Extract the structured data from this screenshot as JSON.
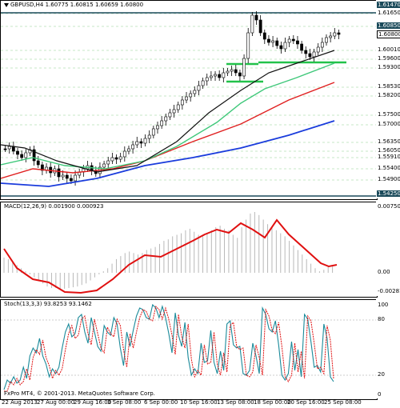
{
  "main": {
    "symbol": "GBPUSD,H4",
    "ohlc": "1.60775 1.60815 1.60659 1.60800",
    "last_price": "1.60800",
    "ticks": [
      "1.6147.0",
      "1.6165.0",
      "1.6085.0",
      "1.60800",
      "1.6001.0",
      "1.5960.0",
      "1.5930.0",
      "1.5853.0",
      "1.5820.0",
      "1.5750.0",
      "1.5700.0",
      "1.5635.0",
      "1.5605.0",
      "1.5591.0",
      "1.5540.0",
      "1.5490.0",
      "1.5425.0"
    ],
    "tick_labels_display": [
      "1.61470",
      "1.61650",
      "1.60850",
      "1.60800",
      "1.60010",
      "1.59600",
      "1.59300",
      "1.58530",
      "1.58200",
      "1.57500",
      "1.57000",
      "1.56350",
      "1.56050",
      "1.55910",
      "1.55400",
      "1.54900",
      "1.54250"
    ],
    "highlight_colors": {
      "dark": "#1a4a5a",
      "green": "#1fa43a",
      "greenLine": "#22c24a"
    }
  },
  "macd": {
    "label": "MACD(12,26,9) 0.001900 0.000923",
    "ticks": [
      "0.007501",
      "0.00",
      "-0.002817"
    ]
  },
  "stoch": {
    "label": "Stoch(13,3,3) 93.8253 93.1462",
    "ticks": [
      "100",
      "80",
      "20",
      "0"
    ]
  },
  "footer": "FxPro MT4, © 2001-2013. MetaQuotes Software Corp.",
  "xaxis": [
    "22 Aug 2013",
    "27 Aug 00:00",
    "29 Aug 16:00",
    "3 Sep 08:00",
    "6 Sep 00:00",
    "10 Sep 16:00",
    "13 Sep 08:00",
    "18 Sep 00:00",
    "20 Sep 16:00",
    "25 Sep 08:00"
  ]
}
